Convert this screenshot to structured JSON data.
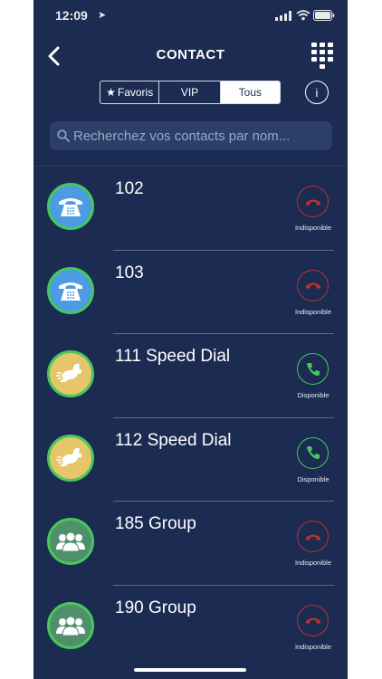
{
  "status_bar": {
    "time": "12:09",
    "location_glyph": "➤"
  },
  "header": {
    "title": "CONTACT",
    "back_icon": "chevron-left-icon",
    "keypad_icon": "keypad-icon"
  },
  "filter": {
    "tabs": [
      {
        "label": "Favoris",
        "icon": "star-icon"
      },
      {
        "label": "VIP"
      },
      {
        "label": "Tous",
        "selected": true
      }
    ],
    "info_label": "i"
  },
  "search": {
    "placeholder": "Recherchez vos contacts par nom..."
  },
  "colors": {
    "background": "#1b2b52",
    "available": "#44c95a",
    "unavailable": "#c0302e",
    "avatar_blue": "#4d9be2",
    "avatar_yellow": "#e6c66a",
    "avatar_green": "#4f8f6c"
  },
  "contacts": [
    {
      "name": "102",
      "type": "phone",
      "status": "Indisponible",
      "available": false
    },
    {
      "name": "103",
      "type": "phone",
      "status": "Indisponible",
      "available": false
    },
    {
      "name": "111 Speed Dial",
      "type": "speed-dial",
      "status": "Disponible",
      "available": true
    },
    {
      "name": "112 Speed Dial",
      "type": "speed-dial",
      "status": "Disponible",
      "available": true
    },
    {
      "name": "185 Group",
      "type": "group",
      "status": "Indisponible",
      "available": false
    },
    {
      "name": "190 Group",
      "type": "group",
      "status": "Indisponible",
      "available": false
    }
  ]
}
